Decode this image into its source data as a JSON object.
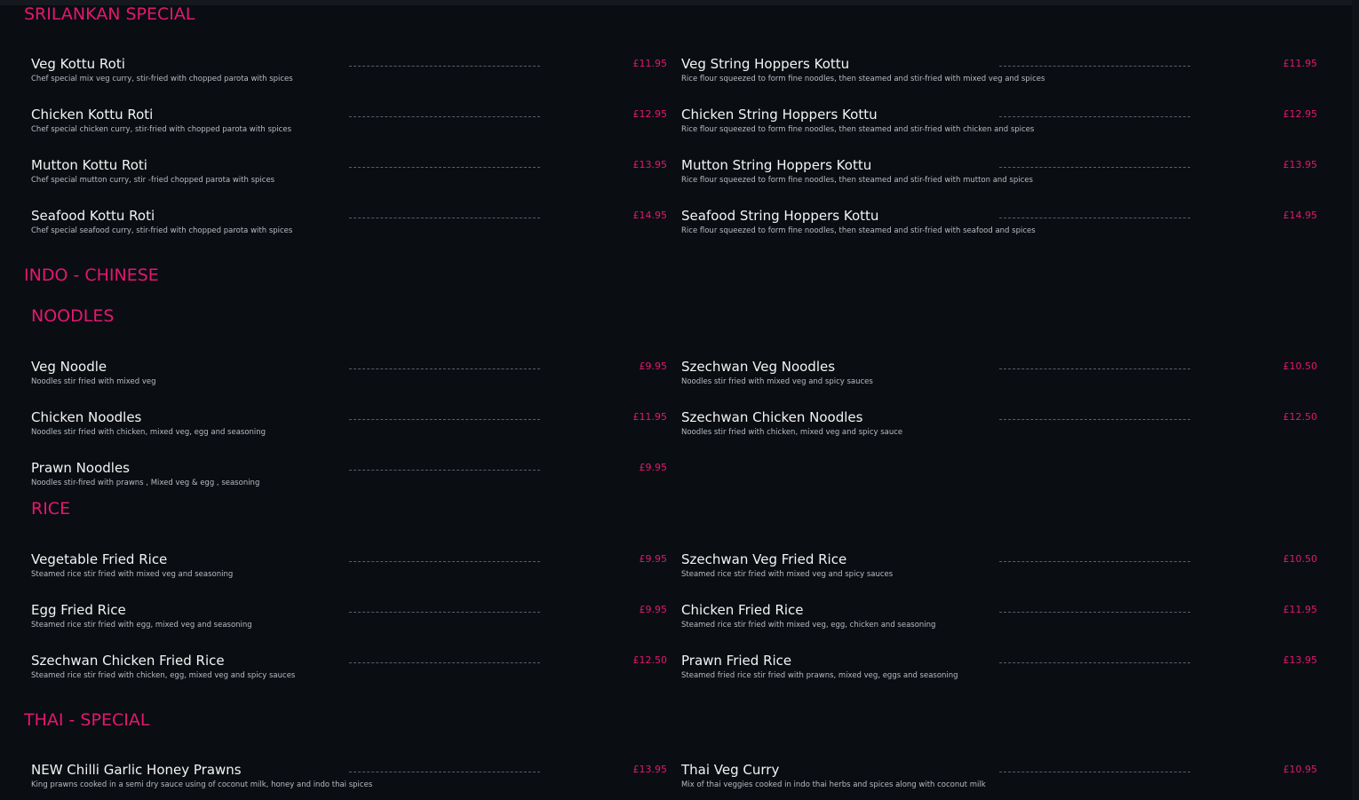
{
  "sections": [
    {
      "title": "SRILANKAN SPECIAL",
      "subsections": [
        {
          "title": "",
          "items": [
            {
              "name": "Veg Kottu Roti",
              "price": "£11.95",
              "desc": "Chef special mix veg curry, stir-fried with chopped parota with spices"
            },
            {
              "name": "Veg String Hoppers Kottu",
              "price": "£11.95",
              "desc": "Rice flour squeezed to form fine noodles, then steamed and stir-fried with mixed veg and spices"
            },
            {
              "name": "Chicken Kottu Roti",
              "price": "£12.95",
              "desc": "Chef special chicken curry, stir-fried with chopped parota with spices"
            },
            {
              "name": "Chicken String Hoppers Kottu",
              "price": "£12.95",
              "desc": "Rice flour squeezed to form fine noodles, then steamed and stir-fried with chicken and spices"
            },
            {
              "name": "Mutton Kottu Roti",
              "price": "£13.95",
              "desc": "Chef special mutton curry, stir -fried chopped parota with spices"
            },
            {
              "name": "Mutton String Hoppers Kottu",
              "price": "£13.95",
              "desc": "Rice flour squeezed to form fine noodles, then steamed and stir-fried with mutton and spices"
            },
            {
              "name": "Seafood Kottu Roti",
              "price": "£14.95",
              "desc": "Chef special seafood curry, stir-fried with chopped parota with spices"
            },
            {
              "name": "Seafood String Hoppers Kottu",
              "price": "£14.95",
              "desc": "Rice flour squeezed to form fine noodles, then steamed and stir-fried with seafood and spices"
            }
          ]
        }
      ]
    },
    {
      "title": "INDO - CHINESE",
      "subsections": [
        {
          "title": "NOODLES",
          "items": [
            {
              "name": "Veg Noodle",
              "price": "£9.95",
              "desc": "Noodles stir fried with mixed veg"
            },
            {
              "name": "Szechwan Veg Noodles",
              "price": "£10.50",
              "desc": "Noodles stir fried with mixed veg and spicy sauces"
            },
            {
              "name": "Chicken Noodles",
              "price": "£11.95",
              "desc": "Noodles stir fried with chicken, mixed veg, egg and seasoning"
            },
            {
              "name": "Szechwan Chicken Noodles",
              "price": "£12.50",
              "desc": "Noodles stir fried with chicken, mixed veg and spicy sauce"
            },
            {
              "name": "Prawn Noodles",
              "price": "£9.95",
              "desc": "Noodles stir-fired with prawns , Mixed veg & egg , seasoning"
            }
          ]
        },
        {
          "title": "RICE",
          "items": [
            {
              "name": "Vegetable Fried Rice",
              "price": "£9.95",
              "desc": "Steamed rice stir fried with mixed veg and seasoning"
            },
            {
              "name": "Szechwan Veg Fried Rice",
              "price": "£10.50",
              "desc": "Steamed rice stir fried with mixed veg and spicy sauces"
            },
            {
              "name": "Egg Fried Rice",
              "price": "£9.95",
              "desc": "Steamed rice stir fried with egg, mixed veg and seasoning"
            },
            {
              "name": "Chicken Fried Rice",
              "price": "£11.95",
              "desc": "Steamed rice stir fried with mixed veg, egg, chicken and seasoning"
            },
            {
              "name": "Szechwan Chicken Fried Rice",
              "price": "£12.50",
              "desc": "Steamed rice stir fried with chicken, egg, mixed veg and spicy sauces"
            },
            {
              "name": "Prawn Fried Rice",
              "price": "£13.95",
              "desc": "Steamed fried rice stir fried with prawns, mixed veg, eggs and seasoning"
            }
          ]
        }
      ]
    },
    {
      "title": "THAI - SPECIAL",
      "subsections": [
        {
          "title": "",
          "items": [
            {
              "name": "NEW Chilli Garlic Honey Prawns",
              "price": "£13.95",
              "desc": "King prawns cooked in a semi dry sauce using of coconut milk, honey and indo thai spices"
            },
            {
              "name": "Thai Veg Curry",
              "price": "£10.95",
              "desc": "Mix of thai veggies cooked in indo thai herbs and spices along with coconut milk"
            }
          ]
        }
      ]
    }
  ]
}
